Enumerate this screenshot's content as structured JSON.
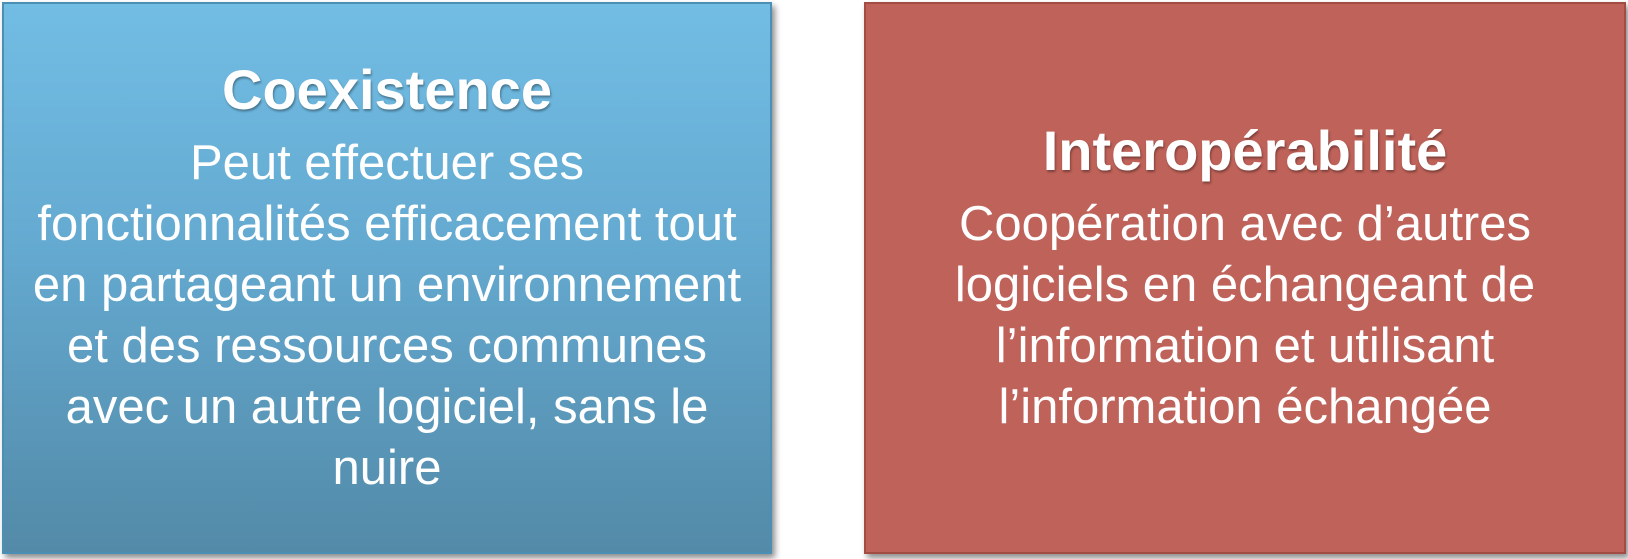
{
  "boxes": [
    {
      "title": "Coexistence",
      "body": "Peut effectuer ses fonctionnalités efficacement tout en partageant un environnement et des ressources communes avec un autre logiciel, sans le nuire",
      "color": "#64a9d0"
    },
    {
      "title": "Interopérabilité",
      "body": "Coopération avec d’autres logiciels en échangeant de l’information et utilisant l’information échangée",
      "color": "#bf6259"
    }
  ]
}
